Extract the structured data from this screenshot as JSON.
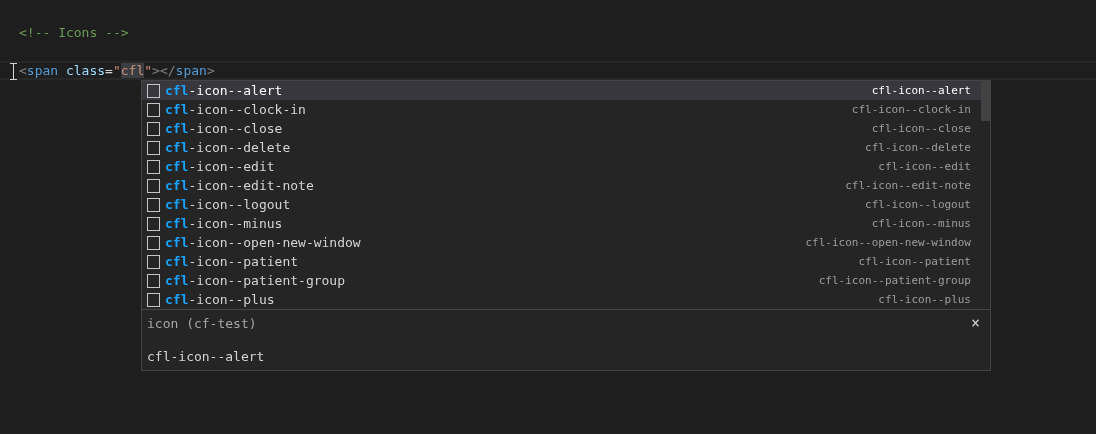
{
  "editor": {
    "lines": [
      {
        "tokens": [
          {
            "text": "<!-- Icons -->",
            "kind": "comment",
            "highlighted": false
          }
        ],
        "current": false
      },
      {
        "current": false
      },
      {
        "tokens": [
          {
            "text": "<",
            "kind": "punct",
            "highlighted": false
          },
          {
            "text": "span",
            "kind": "tag",
            "highlighted": false
          },
          {
            "text": " class",
            "kind": "attr",
            "highlighted": false
          },
          {
            "text": "=",
            "kind": "plain",
            "highlighted": false
          },
          {
            "text": "\"",
            "kind": "string",
            "highlighted": false
          },
          {
            "text": "cfl",
            "kind": "string",
            "highlighted": true
          },
          {
            "text": "\"",
            "kind": "string",
            "highlighted": false
          },
          {
            "text": "></",
            "kind": "punct",
            "highlighted": false
          },
          {
            "text": "span",
            "kind": "tag",
            "highlighted": false
          },
          {
            "text": ">",
            "kind": "punct",
            "highlighted": false
          }
        ],
        "current": true
      }
    ]
  },
  "suggestions": {
    "items": [
      {
        "match": "cfl",
        "rest": "-icon--alert",
        "detail": "cfl-icon--alert",
        "selected": true
      },
      {
        "match": "cfl",
        "rest": "-icon--clock-in",
        "detail": "cfl-icon--clock-in",
        "selected": false
      },
      {
        "match": "cfl",
        "rest": "-icon--close",
        "detail": "cfl-icon--close",
        "selected": false
      },
      {
        "match": "cfl",
        "rest": "-icon--delete",
        "detail": "cfl-icon--delete",
        "selected": false
      },
      {
        "match": "cfl",
        "rest": "-icon--edit",
        "detail": "cfl-icon--edit",
        "selected": false
      },
      {
        "match": "cfl",
        "rest": "-icon--edit-note",
        "detail": "cfl-icon--edit-note",
        "selected": false
      },
      {
        "match": "cfl",
        "rest": "-icon--logout",
        "detail": "cfl-icon--logout",
        "selected": false
      },
      {
        "match": "cfl",
        "rest": "-icon--minus",
        "detail": "cfl-icon--minus",
        "selected": false
      },
      {
        "match": "cfl",
        "rest": "-icon--open-new-window",
        "detail": "cfl-icon--open-new-window",
        "selected": false
      },
      {
        "match": "cfl",
        "rest": "-icon--patient",
        "detail": "cfl-icon--patient",
        "selected": false
      },
      {
        "match": "cfl",
        "rest": "-icon--patient-group",
        "detail": "cfl-icon--patient-group",
        "selected": false
      },
      {
        "match": "cfl",
        "rest": "-icon--plus",
        "detail": "cfl-icon--plus",
        "selected": false
      }
    ],
    "details": {
      "title": "icon (cf-test)",
      "close": "×",
      "documentation": "cfl-icon--alert"
    }
  }
}
